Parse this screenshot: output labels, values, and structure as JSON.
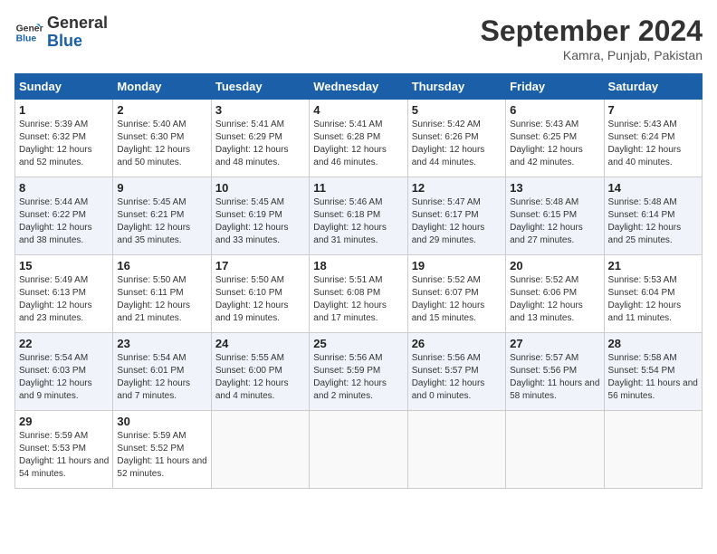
{
  "header": {
    "logo_line1": "General",
    "logo_line2": "Blue",
    "month": "September 2024",
    "location": "Kamra, Punjab, Pakistan"
  },
  "days_of_week": [
    "Sunday",
    "Monday",
    "Tuesday",
    "Wednesday",
    "Thursday",
    "Friday",
    "Saturday"
  ],
  "weeks": [
    [
      {
        "num": "1",
        "sunrise": "5:39 AM",
        "sunset": "6:32 PM",
        "daylight": "12 hours and 52 minutes."
      },
      {
        "num": "2",
        "sunrise": "5:40 AM",
        "sunset": "6:30 PM",
        "daylight": "12 hours and 50 minutes."
      },
      {
        "num": "3",
        "sunrise": "5:41 AM",
        "sunset": "6:29 PM",
        "daylight": "12 hours and 48 minutes."
      },
      {
        "num": "4",
        "sunrise": "5:41 AM",
        "sunset": "6:28 PM",
        "daylight": "12 hours and 46 minutes."
      },
      {
        "num": "5",
        "sunrise": "5:42 AM",
        "sunset": "6:26 PM",
        "daylight": "12 hours and 44 minutes."
      },
      {
        "num": "6",
        "sunrise": "5:43 AM",
        "sunset": "6:25 PM",
        "daylight": "12 hours and 42 minutes."
      },
      {
        "num": "7",
        "sunrise": "5:43 AM",
        "sunset": "6:24 PM",
        "daylight": "12 hours and 40 minutes."
      }
    ],
    [
      {
        "num": "8",
        "sunrise": "5:44 AM",
        "sunset": "6:22 PM",
        "daylight": "12 hours and 38 minutes."
      },
      {
        "num": "9",
        "sunrise": "5:45 AM",
        "sunset": "6:21 PM",
        "daylight": "12 hours and 35 minutes."
      },
      {
        "num": "10",
        "sunrise": "5:45 AM",
        "sunset": "6:19 PM",
        "daylight": "12 hours and 33 minutes."
      },
      {
        "num": "11",
        "sunrise": "5:46 AM",
        "sunset": "6:18 PM",
        "daylight": "12 hours and 31 minutes."
      },
      {
        "num": "12",
        "sunrise": "5:47 AM",
        "sunset": "6:17 PM",
        "daylight": "12 hours and 29 minutes."
      },
      {
        "num": "13",
        "sunrise": "5:48 AM",
        "sunset": "6:15 PM",
        "daylight": "12 hours and 27 minutes."
      },
      {
        "num": "14",
        "sunrise": "5:48 AM",
        "sunset": "6:14 PM",
        "daylight": "12 hours and 25 minutes."
      }
    ],
    [
      {
        "num": "15",
        "sunrise": "5:49 AM",
        "sunset": "6:13 PM",
        "daylight": "12 hours and 23 minutes."
      },
      {
        "num": "16",
        "sunrise": "5:50 AM",
        "sunset": "6:11 PM",
        "daylight": "12 hours and 21 minutes."
      },
      {
        "num": "17",
        "sunrise": "5:50 AM",
        "sunset": "6:10 PM",
        "daylight": "12 hours and 19 minutes."
      },
      {
        "num": "18",
        "sunrise": "5:51 AM",
        "sunset": "6:08 PM",
        "daylight": "12 hours and 17 minutes."
      },
      {
        "num": "19",
        "sunrise": "5:52 AM",
        "sunset": "6:07 PM",
        "daylight": "12 hours and 15 minutes."
      },
      {
        "num": "20",
        "sunrise": "5:52 AM",
        "sunset": "6:06 PM",
        "daylight": "12 hours and 13 minutes."
      },
      {
        "num": "21",
        "sunrise": "5:53 AM",
        "sunset": "6:04 PM",
        "daylight": "12 hours and 11 minutes."
      }
    ],
    [
      {
        "num": "22",
        "sunrise": "5:54 AM",
        "sunset": "6:03 PM",
        "daylight": "12 hours and 9 minutes."
      },
      {
        "num": "23",
        "sunrise": "5:54 AM",
        "sunset": "6:01 PM",
        "daylight": "12 hours and 7 minutes."
      },
      {
        "num": "24",
        "sunrise": "5:55 AM",
        "sunset": "6:00 PM",
        "daylight": "12 hours and 4 minutes."
      },
      {
        "num": "25",
        "sunrise": "5:56 AM",
        "sunset": "5:59 PM",
        "daylight": "12 hours and 2 minutes."
      },
      {
        "num": "26",
        "sunrise": "5:56 AM",
        "sunset": "5:57 PM",
        "daylight": "12 hours and 0 minutes."
      },
      {
        "num": "27",
        "sunrise": "5:57 AM",
        "sunset": "5:56 PM",
        "daylight": "11 hours and 58 minutes."
      },
      {
        "num": "28",
        "sunrise": "5:58 AM",
        "sunset": "5:54 PM",
        "daylight": "11 hours and 56 minutes."
      }
    ],
    [
      {
        "num": "29",
        "sunrise": "5:59 AM",
        "sunset": "5:53 PM",
        "daylight": "11 hours and 54 minutes."
      },
      {
        "num": "30",
        "sunrise": "5:59 AM",
        "sunset": "5:52 PM",
        "daylight": "11 hours and 52 minutes."
      },
      null,
      null,
      null,
      null,
      null
    ]
  ]
}
